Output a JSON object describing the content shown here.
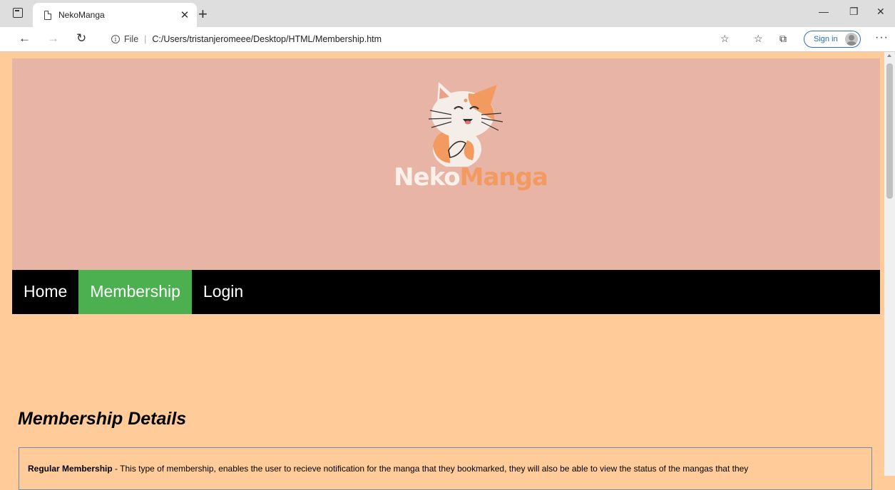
{
  "browser": {
    "tab_title": "NekoManga",
    "url_scheme_label": "File",
    "url": "C:/Users/tristanjeromeee/Desktop/HTML/Membership.htm",
    "sign_in_label": "Sign in"
  },
  "site": {
    "logo_word_1": "Neko",
    "logo_word_2": "Manga",
    "nav": [
      {
        "label": "Home"
      },
      {
        "label": "Membership"
      },
      {
        "label": "Login"
      }
    ],
    "active_nav": "Membership"
  },
  "content": {
    "section_title": "Membership Details",
    "regular": {
      "label": "Regular Membership",
      "text": " - This type of membership, enables the user to recieve notification for the manga that they bookmarked, they will also be able to view the status of the mangas that they"
    }
  },
  "colors": {
    "page_bg": "#ffcc99",
    "banner_bg": "#e8b4a6",
    "nav_bg": "#000000",
    "nav_active": "#4caf50",
    "logo_accent": "#f29a5f"
  }
}
